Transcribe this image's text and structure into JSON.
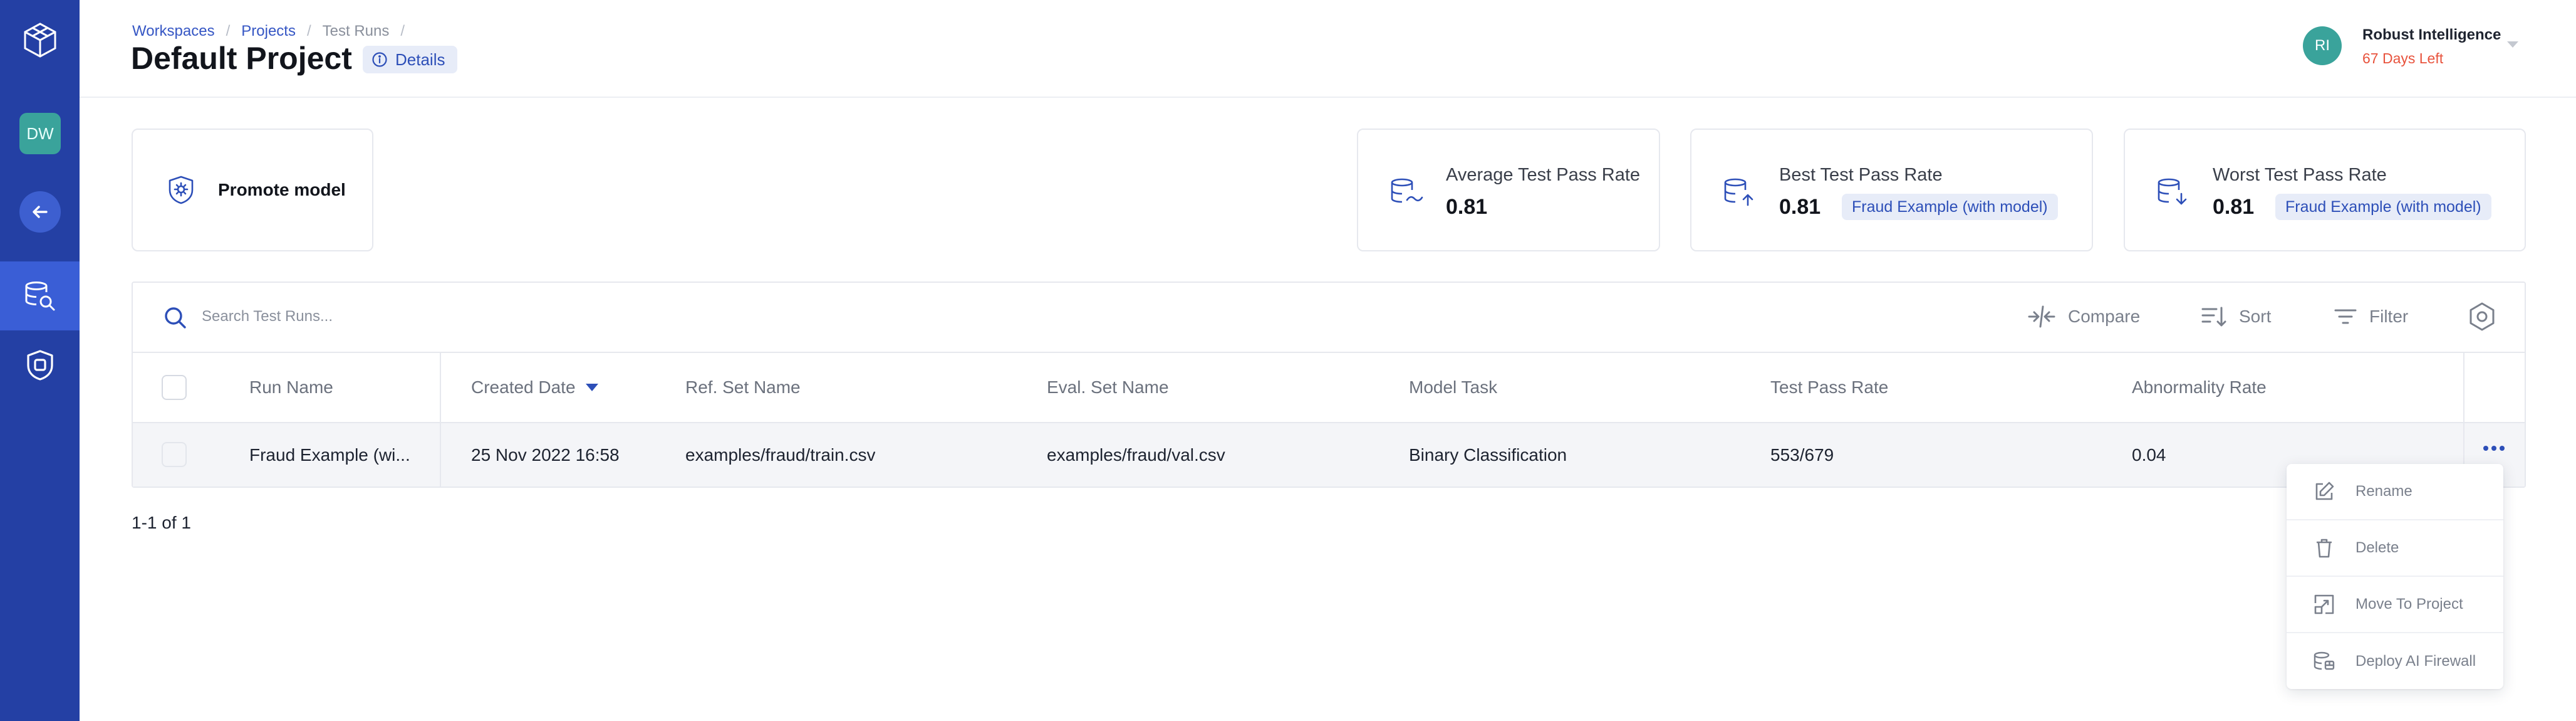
{
  "sidebar": {
    "workspace_initials": "DW"
  },
  "header": {
    "breadcrumb": [
      "Workspaces",
      "Projects",
      "Test Runs"
    ],
    "title": "Default Project",
    "details_label": "Details",
    "user": {
      "initials": "RI",
      "org": "Robust Intelligence",
      "trial": "67 Days Left"
    }
  },
  "promote": {
    "label": "Promote model"
  },
  "stats": {
    "average": {
      "label": "Average Test Pass Rate",
      "value": "0.81"
    },
    "best": {
      "label": "Best Test Pass Rate",
      "value": "0.81",
      "badge": "Fraud Example (with model)"
    },
    "worst": {
      "label": "Worst Test Pass Rate",
      "value": "0.81",
      "badge": "Fraud Example (with model)"
    }
  },
  "toolbar": {
    "search_placeholder": "Search Test Runs...",
    "compare": "Compare",
    "sort": "Sort",
    "filter": "Filter"
  },
  "table": {
    "columns": [
      "Run Name",
      "Created Date",
      "Ref. Set Name",
      "Eval. Set Name",
      "Model Task",
      "Test Pass Rate",
      "Abnormality Rate"
    ],
    "rows": [
      [
        "Fraud Example (wi...",
        "25 Nov 2022 16:58",
        "examples/fraud/train.csv",
        "examples/fraud/val.csv",
        "Binary Classification",
        "553/679",
        "0.04"
      ]
    ]
  },
  "pagination": "1-1 of 1",
  "row_menu": {
    "items": [
      "Rename",
      "Delete",
      "Move To Project",
      "Deploy AI Firewall"
    ]
  },
  "colors": {
    "sidebar": "#2440a4",
    "accent": "#2d4fb8",
    "teal": "#3aa39b",
    "warning": "#e8533d"
  }
}
